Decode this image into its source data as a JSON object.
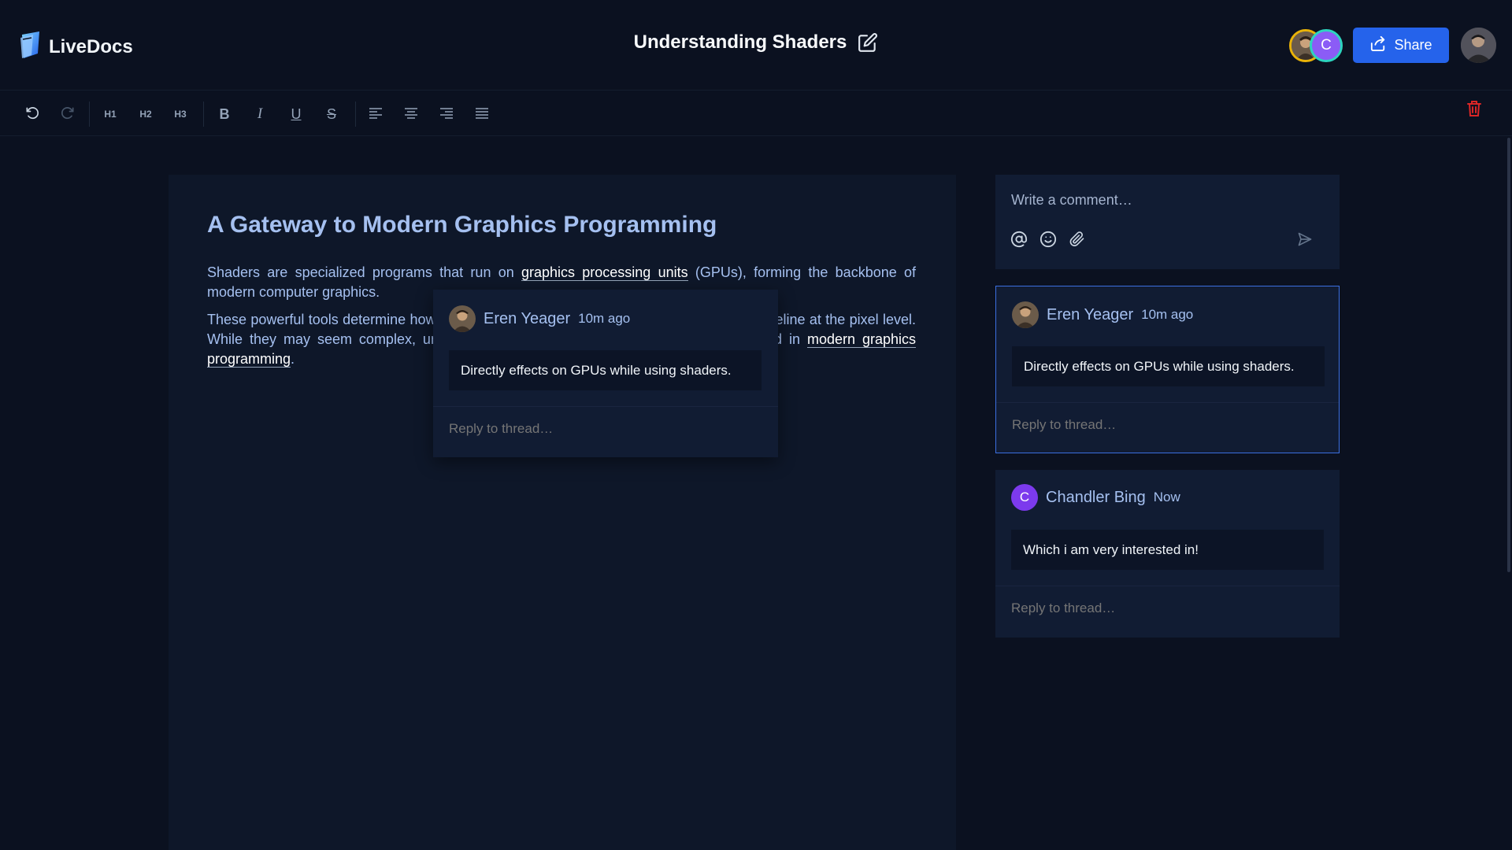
{
  "app": {
    "name": "LiveDocs"
  },
  "document": {
    "title": "Understanding Shaders"
  },
  "header": {
    "share_label": "Share",
    "collaborators": [
      {
        "name": "Eren Yeager",
        "initial": ""
      },
      {
        "name": "Chandler Bing",
        "initial": "C"
      }
    ]
  },
  "toolbar": {
    "h1": "H1",
    "h2": "H2",
    "h3": "H3",
    "bold": "B",
    "italic": "I",
    "underline": "U",
    "strike": "S"
  },
  "editor": {
    "heading": "A Gateway to Modern Graphics Programming",
    "p1_a": "Shaders are specialized programs that run on ",
    "p1_link": "graphics processing units",
    "p1_b": " (GPUs), forming the backbone of modern computer graphics.",
    "p2_a": "These powerful tools determine how every pixel is processed throughout the rendering pipeline at the pixel level. While they may seem complex, understanding shaders is crucial for anyone interested in ",
    "p2_link": "modern graphics programming",
    "p2_b": "."
  },
  "popover": {
    "author": "Eren Yeager",
    "time": "10m ago",
    "body": "Directly effects on GPUs while using shaders.",
    "reply_placeholder": "Reply to thread…"
  },
  "composer": {
    "placeholder": "Write a comment…"
  },
  "threads": [
    {
      "author": "Eren Yeager",
      "time": "10m ago",
      "body": "Directly effects on GPUs while using shaders.",
      "reply_placeholder": "Reply to thread…"
    },
    {
      "author": "Chandler Bing",
      "initial": "C",
      "time": "Now",
      "body": "Which i am very interested in!",
      "reply_placeholder": "Reply to thread…"
    }
  ],
  "colors": {
    "background": "#0b1120",
    "panel": "#111c33",
    "accent": "#2563eb",
    "active_border": "#3b6fe0",
    "delete": "#dc2626",
    "text_soft": "#a5c0f0"
  }
}
